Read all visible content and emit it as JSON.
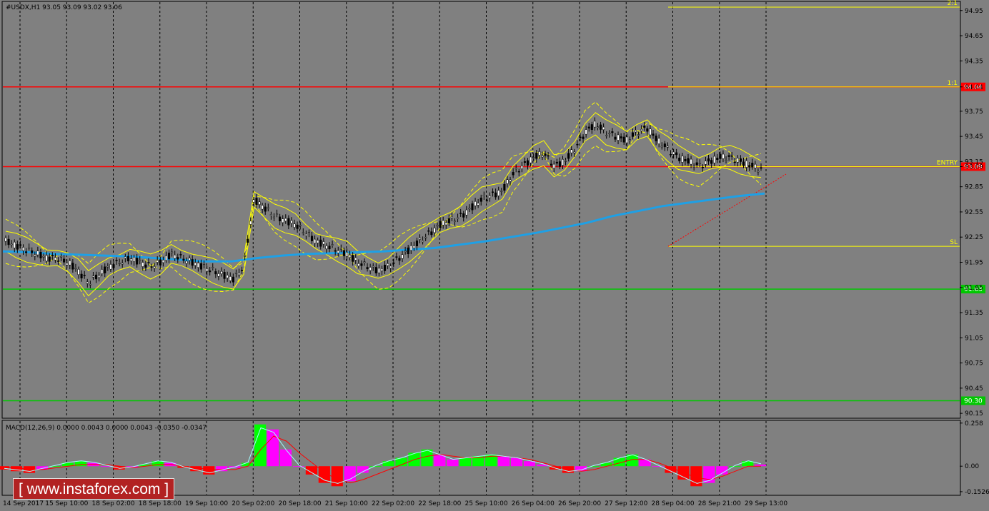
{
  "symbol_header": "#USDX,H1  93.05 93.09 93.02 93.06",
  "macd_header": "MACD(12,26,9) 0.0000 0.0043 0.0000 0.0043 -0.0350 -0.0347",
  "watermark": "[ www.instaforex.com ]",
  "colors": {
    "background": "#808080",
    "frame": "#000000",
    "resistance": "#ff0000",
    "support": "#00c800",
    "ma": "#1ea0e6",
    "bands": "#ffff00",
    "target": "#ffff00",
    "macd_up": "#00ff00",
    "macd_down": "#ff0000",
    "macd_pink": "#ff00ff",
    "macd_signal": "#ff0000",
    "macd_line": "#a0ffff"
  },
  "chart_data": [
    {
      "type": "candlestick",
      "title": "#USDX,H1",
      "x_tick_labels": [
        "14 Sep 2017",
        "15 Sep 10:00",
        "18 Sep 02:00",
        "18 Sep 18:00",
        "19 Sep 10:00",
        "20 Sep 02:00",
        "20 Sep 18:00",
        "21 Sep 10:00",
        "22 Sep 02:00",
        "22 Sep 18:00",
        "25 Sep 10:00",
        "26 Sep 04:00",
        "26 Sep 20:00",
        "27 Sep 12:00",
        "28 Sep 04:00",
        "28 Sep 21:00",
        "29 Sep 13:00"
      ],
      "y_ticks": [
        "94.95",
        "94.65",
        "94.35",
        "94.04",
        "93.75",
        "93.45",
        "93.15",
        "93.09",
        "92.85",
        "92.55",
        "92.25",
        "91.95",
        "91.65",
        "91.35",
        "91.05",
        "90.75",
        "90.45",
        "90.15"
      ],
      "ylim": [
        90.1,
        95.05
      ],
      "price_path": [
        92.2,
        92.15,
        92.1,
        92.05,
        92.0,
        92.0,
        91.95,
        91.85,
        91.7,
        91.8,
        91.9,
        91.95,
        92.0,
        91.95,
        91.9,
        91.95,
        92.05,
        92.0,
        91.95,
        91.9,
        91.85,
        91.8,
        91.75,
        91.9,
        92.7,
        92.6,
        92.5,
        92.45,
        92.4,
        92.3,
        92.2,
        92.15,
        92.1,
        92.05,
        91.95,
        91.9,
        91.85,
        91.9,
        92.0,
        92.1,
        92.2,
        92.3,
        92.4,
        92.45,
        92.5,
        92.6,
        92.7,
        92.75,
        92.8,
        93.0,
        93.1,
        93.2,
        93.25,
        93.1,
        93.15,
        93.3,
        93.5,
        93.6,
        93.5,
        93.45,
        93.4,
        93.5,
        93.55,
        93.4,
        93.3,
        93.2,
        93.15,
        93.1,
        93.15,
        93.2,
        93.2,
        93.15,
        93.1,
        93.06
      ],
      "ma_path": [
        92.08,
        92.07,
        92.05,
        92.04,
        92.03,
        92.02,
        92.0,
        91.98,
        91.96,
        91.96,
        92.0,
        92.03,
        92.05,
        92.06,
        92.07,
        92.08,
        92.1,
        92.12,
        92.16,
        92.2,
        92.25,
        92.3,
        92.36,
        92.42,
        92.5,
        92.56,
        92.62,
        92.66,
        92.7,
        92.74,
        92.77
      ],
      "levels": [
        {
          "label": "94.04",
          "value": 94.04,
          "kind": "resistance"
        },
        {
          "label": "93.09",
          "value": 93.09,
          "kind": "resistance"
        },
        {
          "label": "91.63",
          "value": 91.63,
          "kind": "support"
        },
        {
          "label": "90.30",
          "value": 90.3,
          "kind": "support"
        }
      ],
      "targets": [
        {
          "label": "2:1",
          "value": 94.99
        },
        {
          "label": "1:1",
          "value": 94.04
        },
        {
          "label": "ENTRY",
          "value": 93.09
        },
        {
          "label": "SL",
          "value": 92.14
        }
      ],
      "last_price_label": "93.06"
    },
    {
      "type": "bar",
      "title": "MACD(12,26,9)",
      "y_ticks": [
        "0.258",
        "0.00",
        "-0.1526"
      ],
      "ylim": [
        -0.17,
        0.27
      ],
      "histogram": [
        -0.02,
        -0.03,
        -0.04,
        -0.02,
        0.0,
        0.02,
        0.03,
        0.02,
        0.0,
        -0.02,
        -0.01,
        0.01,
        0.03,
        0.02,
        -0.01,
        -0.03,
        -0.05,
        -0.03,
        -0.01,
        0.02,
        0.25,
        0.22,
        0.1,
        0.0,
        -0.05,
        -0.1,
        -0.12,
        -0.09,
        -0.04,
        0.0,
        0.03,
        0.05,
        0.08,
        0.1,
        0.07,
        0.04,
        0.05,
        0.06,
        0.07,
        0.06,
        0.05,
        0.03,
        0.01,
        -0.02,
        -0.04,
        -0.03,
        0.0,
        0.02,
        0.05,
        0.07,
        0.04,
        0.0,
        -0.04,
        -0.08,
        -0.12,
        -0.1,
        -0.05,
        0.0,
        0.03,
        0.01
      ],
      "signal": [
        -0.01,
        -0.01,
        -0.02,
        -0.02,
        -0.01,
        0.0,
        0.01,
        0.01,
        0.01,
        0.0,
        -0.01,
        0.0,
        0.01,
        0.01,
        0.0,
        -0.01,
        -0.02,
        -0.02,
        -0.02,
        0.0,
        0.1,
        0.18,
        0.15,
        0.08,
        0.02,
        -0.04,
        -0.08,
        -0.1,
        -0.08,
        -0.05,
        -0.02,
        0.01,
        0.04,
        0.06,
        0.07,
        0.06,
        0.05,
        0.05,
        0.06,
        0.06,
        0.05,
        0.04,
        0.02,
        0.0,
        -0.02,
        -0.03,
        -0.02,
        0.0,
        0.02,
        0.04,
        0.04,
        0.02,
        -0.01,
        -0.04,
        -0.07,
        -0.08,
        -0.06,
        -0.03,
        0.0,
        0.0
      ]
    }
  ]
}
